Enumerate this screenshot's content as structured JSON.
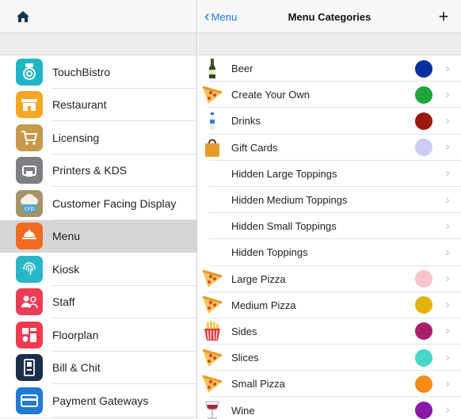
{
  "left_panel": {
    "home_icon": "home-icon",
    "items": [
      {
        "label": "TouchBistro",
        "icon": "touchbistro-icon",
        "color": "#21b5c8",
        "selected": false
      },
      {
        "label": "Restaurant",
        "icon": "restaurant-icon",
        "color": "#f5a623",
        "selected": false
      },
      {
        "label": "Licensing",
        "icon": "cart-icon",
        "color": "#c59a49",
        "selected": false
      },
      {
        "label": "Printers & KDS",
        "icon": "printer-icon",
        "color": "#7e7e84",
        "selected": false
      },
      {
        "label": "Customer Facing Display",
        "icon": "cfd-icon",
        "color": "#a4926a",
        "cfd_badge": "CFD",
        "selected": false
      },
      {
        "label": "Menu",
        "icon": "menu-icon",
        "color": "#f26b21",
        "selected": true
      },
      {
        "label": "Kiosk",
        "icon": "kiosk-icon",
        "color": "#28b7c9",
        "selected": false
      },
      {
        "label": "Staff",
        "icon": "staff-icon",
        "color": "#ec3b57",
        "selected": false
      },
      {
        "label": "Floorplan",
        "icon": "floorplan-icon",
        "color": "#ef3a4f",
        "selected": false
      },
      {
        "label": "Bill & Chit",
        "icon": "bill-icon",
        "color": "#1c2e4a",
        "selected": false
      },
      {
        "label": "Payment Gateways",
        "icon": "payment-icon",
        "color": "#1f7bd6",
        "selected": false
      }
    ]
  },
  "right_panel": {
    "back_label": "Menu",
    "title": "Menu Categories",
    "add_glyph": "+",
    "categories": [
      {
        "label": "Beer",
        "icon": "beer-bottle-icon",
        "color": "#0a2f9e"
      },
      {
        "label": "Create Your Own",
        "icon": "pizza-slice-icon",
        "color": "#1fa53a"
      },
      {
        "label": "Drinks",
        "icon": "drink-bottle-icon",
        "color": "#9b1a0d"
      },
      {
        "label": "Gift Cards",
        "icon": "gift-bag-icon",
        "color": "#ccccf7"
      },
      {
        "label": "Hidden Large Toppings",
        "icon": "",
        "color": ""
      },
      {
        "label": "Hidden Medium Toppings",
        "icon": "",
        "color": ""
      },
      {
        "label": "Hidden Small Toppings",
        "icon": "",
        "color": ""
      },
      {
        "label": "Hidden Toppings",
        "icon": "",
        "color": ""
      },
      {
        "label": "Large Pizza",
        "icon": "pizza-slice-icon",
        "color": "#f8c3cc"
      },
      {
        "label": "Medium Pizza",
        "icon": "pizza-slice-icon",
        "color": "#e3b20a"
      },
      {
        "label": "Sides",
        "icon": "fries-icon",
        "color": "#a8206b"
      },
      {
        "label": "Slices",
        "icon": "pizza-slice-icon",
        "color": "#49d6c8"
      },
      {
        "label": "Small Pizza",
        "icon": "pizza-slice-icon",
        "color": "#f58a18"
      },
      {
        "label": "Wine",
        "icon": "wine-glass-icon",
        "color": "#8a1aa6"
      }
    ]
  }
}
